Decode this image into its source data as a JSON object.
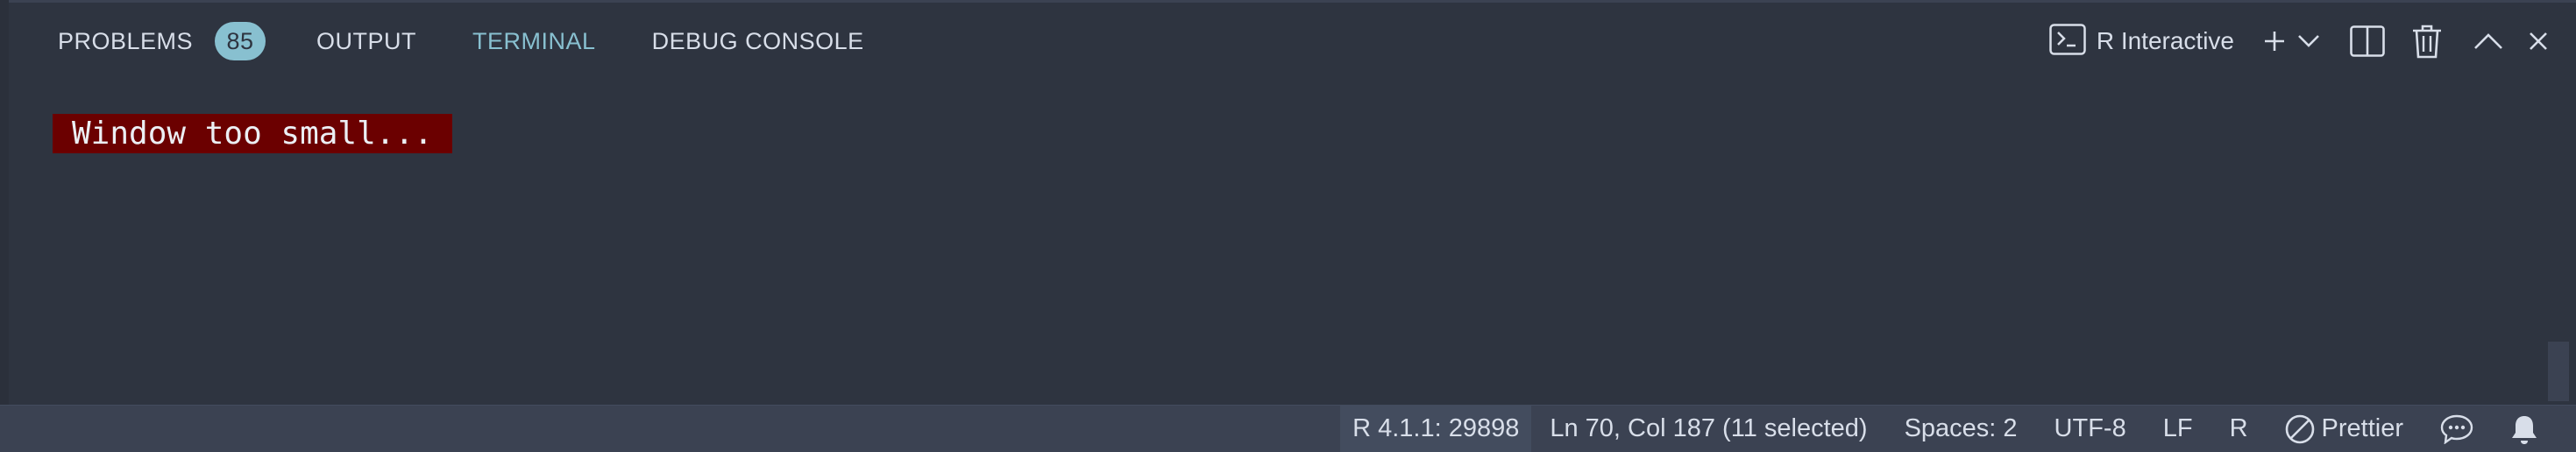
{
  "panel": {
    "tabs": [
      {
        "label": "PROBLEMS",
        "badge": "85"
      },
      {
        "label": "OUTPUT"
      },
      {
        "label": "TERMINAL",
        "active": true
      },
      {
        "label": "DEBUG CONSOLE"
      }
    ],
    "terminal_selector": {
      "icon": "terminal-icon",
      "label": "R Interactive"
    },
    "actions": [
      {
        "icon": "plus-icon",
        "title": "New Terminal"
      },
      {
        "icon": "chevron-down-icon",
        "title": "Launch Profile"
      },
      {
        "icon": "split-icon",
        "title": "Split Terminal"
      },
      {
        "icon": "trash-icon",
        "title": "Kill Terminal"
      },
      {
        "icon": "chevron-up-icon",
        "title": "Maximize Panel"
      },
      {
        "icon": "close-icon",
        "title": "Close Panel"
      }
    ]
  },
  "terminal": {
    "message": "Window too small..."
  },
  "statusbar": {
    "items": [
      {
        "label": "R 4.1.1: 29898"
      },
      {
        "label": "Ln 70, Col 187 (11 selected)"
      },
      {
        "label": "Spaces: 2"
      },
      {
        "label": "UTF-8"
      },
      {
        "label": "LF"
      },
      {
        "label": "R"
      },
      {
        "label": "Prettier",
        "icon": "prettier-icon"
      },
      {
        "icon": "feedback-icon"
      },
      {
        "icon": "bell-icon"
      }
    ]
  },
  "colors": {
    "background": "#2e3440",
    "accent": "#88c0d0",
    "text": "#d8dee9",
    "terminal_message_bg": "#6b0000",
    "statusbar_bg": "#3b4252"
  }
}
